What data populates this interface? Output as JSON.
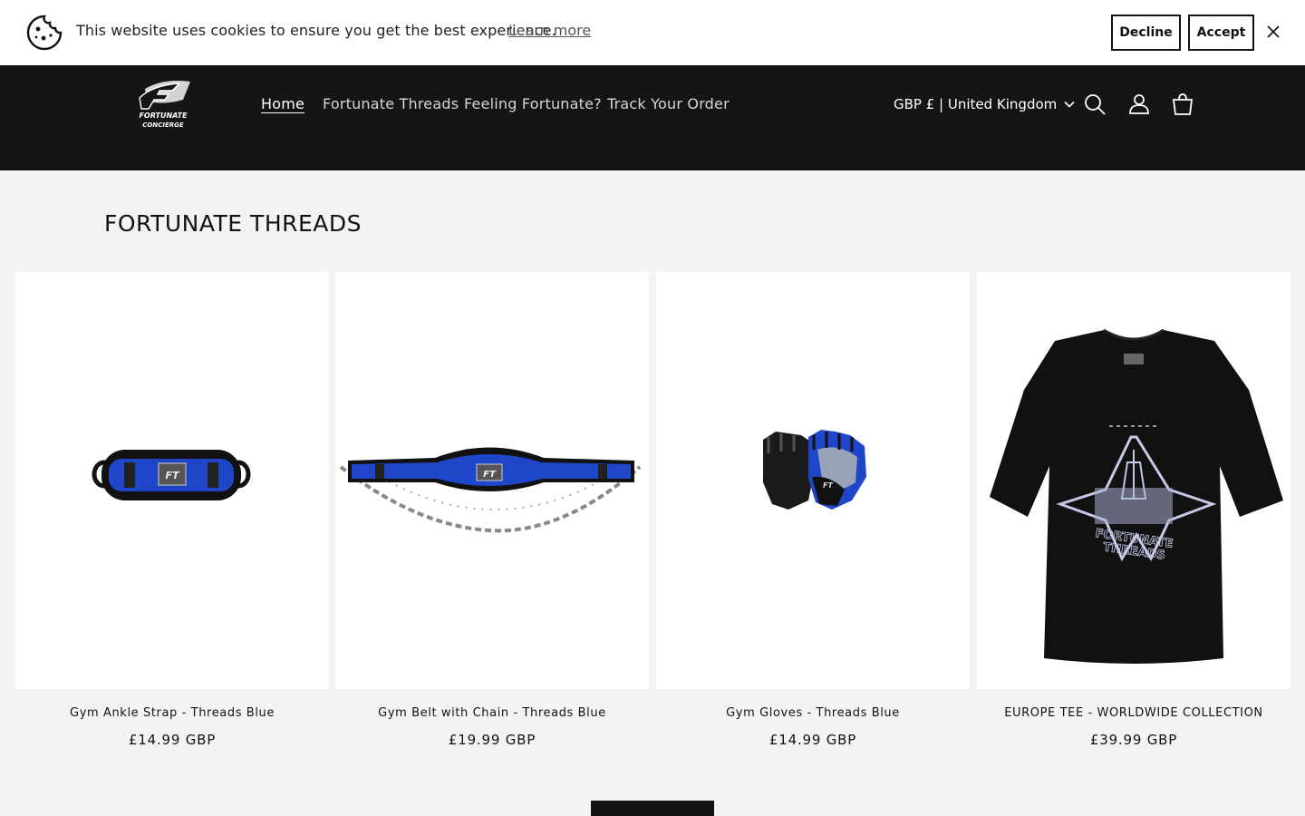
{
  "cookie_banner": {
    "message": "This website uses cookies to ensure you get the best experience.",
    "learn_more": "Learn more",
    "decline": "Decline",
    "accept": "Accept",
    "icons": {
      "cookie": "cookie-icon",
      "close": "close-icon"
    }
  },
  "header": {
    "logo_text": [
      "FORTUNATE",
      "CONCIERGE"
    ],
    "nav": [
      "Home",
      "Fortunate Threads",
      "Feeling Fortunate?",
      "Track Your Order"
    ],
    "active_nav": "Home",
    "currency": "GBP £ | United Kingdom",
    "icons": [
      "search-icon",
      "account-icon",
      "cart-icon"
    ]
  },
  "collection": {
    "title": "FORTUNATE THREADS",
    "products": [
      {
        "title": "Gym Ankle Strap - Threads Blue",
        "price": "£14.99 GBP"
      },
      {
        "title": "Gym Belt with Chain - Threads Blue",
        "price": "£19.99 GBP"
      },
      {
        "title": "Gym Gloves - Threads Blue",
        "price": "£14.99 GBP"
      },
      {
        "title": "EUROPE TEE - WORLDWIDE COLLECTION",
        "price": "£39.99 GBP"
      }
    ]
  },
  "colors": {
    "header_bg": "#151515",
    "page_bg": "#f3f3f3",
    "accent_blue": "#1f46c9"
  }
}
